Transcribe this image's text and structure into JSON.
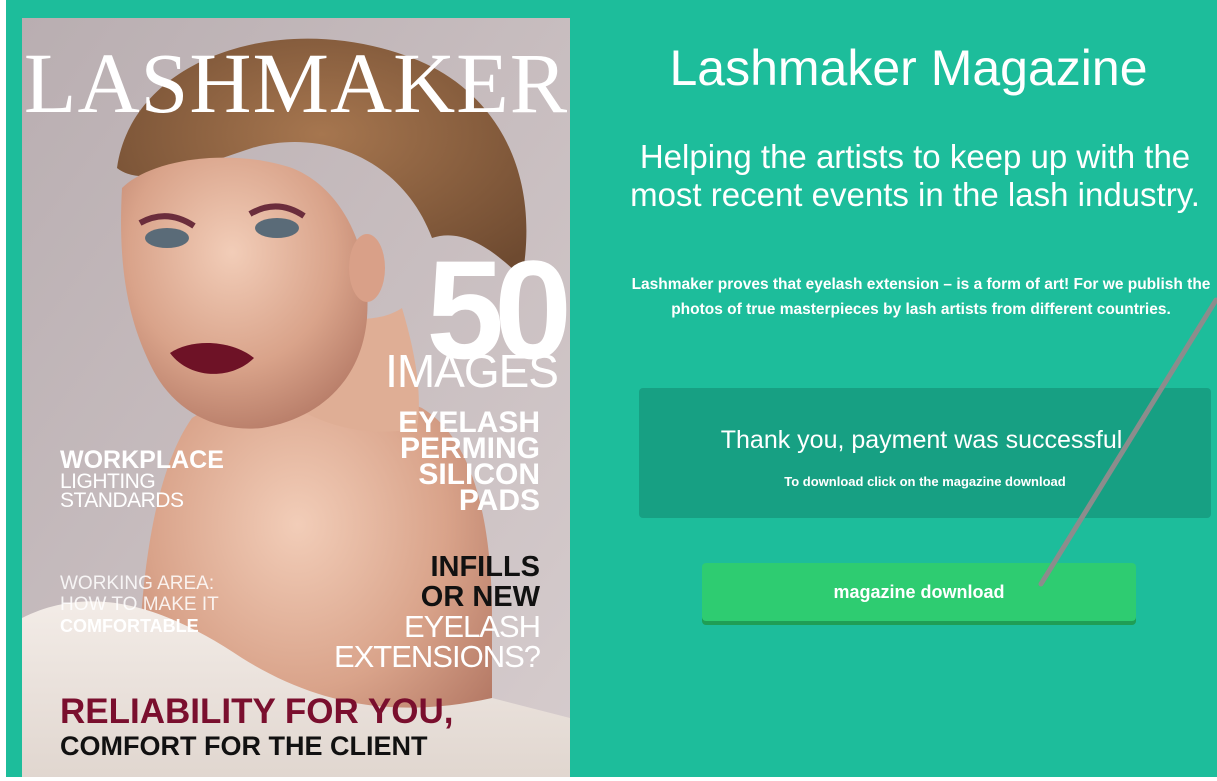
{
  "cover": {
    "title": "LASHMAKER",
    "number": "50",
    "images_word": "IMAGES",
    "eyelash_lines": [
      "EYELASH",
      "PERMING",
      "SILICON",
      "PADS"
    ],
    "workplace": {
      "bold": "WORKPLACE",
      "lines": [
        "LIGHTING",
        "STANDARDS"
      ]
    },
    "working_area": {
      "lines": [
        "WORKING AREA:",
        "HOW TO MAKE IT"
      ],
      "bold": "COMFORTABLE"
    },
    "infills": {
      "bold_lines": [
        "INFILLS",
        "OR NEW"
      ],
      "lines": [
        "EYELASH",
        "EXTENSIONS?"
      ]
    },
    "reliability": {
      "line1": "RELIABILITY FOR YOU,",
      "line2": "COMFORT FOR THE CLIENT"
    }
  },
  "main": {
    "heading": "Lashmaker Magazine",
    "subheading": "Helping the artists to keep up with the most recent events in the lash industry.",
    "description": "Lashmaker proves that eyelash extension – is a form of art! For we publish the photos of true masterpieces by lash artists from different countries."
  },
  "payment_panel": {
    "title": "Thank you, payment was successful.",
    "subtitle": "To download click on the magazine download"
  },
  "download_button": {
    "label": "magazine download"
  },
  "colors": {
    "page_background": "#1dbd9b",
    "panel_background": "#17a083",
    "button_background": "#2ecc71",
    "accent_wine": "#7a0f2e"
  }
}
